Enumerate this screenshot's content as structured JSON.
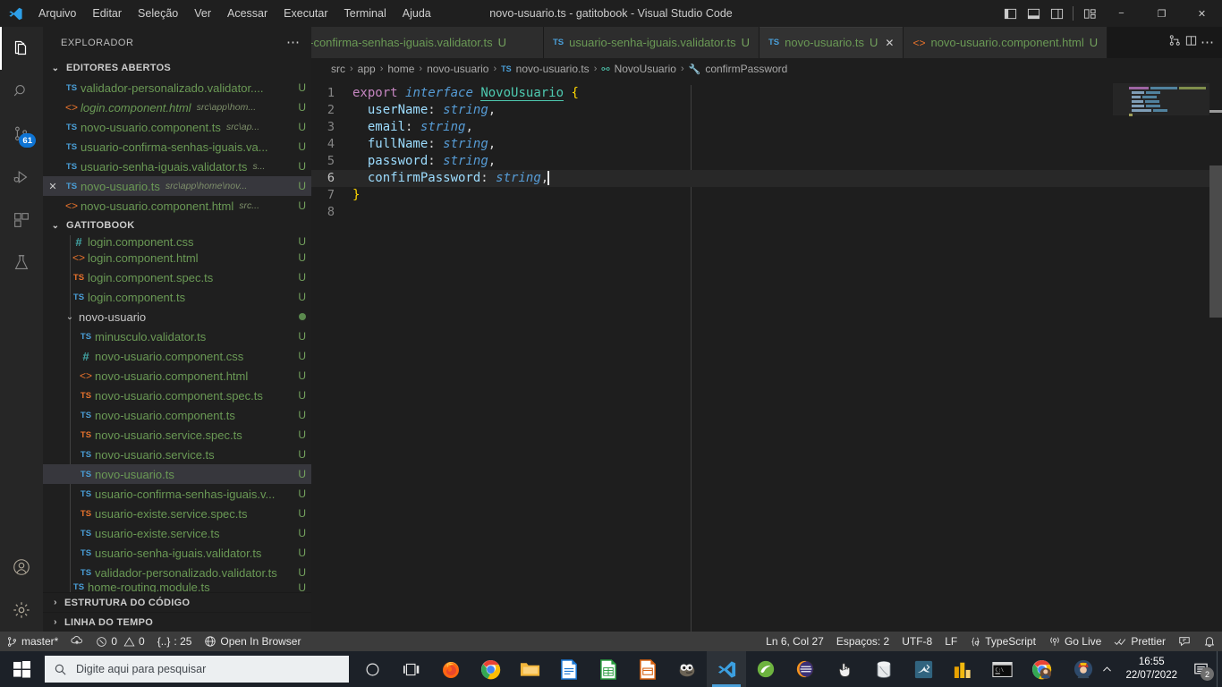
{
  "titlebar": {
    "logo_icon": "vscode-logo-icon",
    "menus": [
      "Arquivo",
      "Editar",
      "Seleção",
      "Ver",
      "Acessar",
      "Executar",
      "Terminal",
      "Ajuda"
    ],
    "window_title": "novo-usuario.ts - gatitobook - Visual Studio Code",
    "layout_icons": [
      "panel-left-icon",
      "panel-bottom-icon",
      "panel-right-icon",
      "customize-layout-icon"
    ],
    "minimize": "−",
    "maximize": "❐",
    "close": "✕"
  },
  "activitybar": {
    "items": [
      {
        "name": "explorer",
        "icon": "files-icon",
        "active": true,
        "badge": ""
      },
      {
        "name": "search",
        "icon": "search-icon",
        "active": false,
        "badge": ""
      },
      {
        "name": "source-control",
        "icon": "source-control-icon",
        "active": false,
        "badge": "61"
      },
      {
        "name": "run-and-debug",
        "icon": "run-debug-icon",
        "active": false,
        "badge": ""
      },
      {
        "name": "extensions",
        "icon": "extensions-icon",
        "active": false,
        "badge": ""
      },
      {
        "name": "testing",
        "icon": "beaker-icon",
        "active": false,
        "badge": ""
      }
    ],
    "bottom": [
      {
        "name": "accounts",
        "icon": "account-icon"
      },
      {
        "name": "manage",
        "icon": "gear-icon"
      }
    ]
  },
  "sidebar": {
    "title": "EXPLORADOR",
    "more_actions": "⋯",
    "open_editors": {
      "label": "EDITORES ABERTOS",
      "items": [
        {
          "icon": "ts",
          "name": "validador-personalizado.validator....",
          "desc": "",
          "status": "U",
          "selected": false,
          "italic": false,
          "close": false
        },
        {
          "icon": "html",
          "name": "login.component.html",
          "desc": "src\\app\\hom...",
          "status": "U",
          "selected": false,
          "italic": true,
          "close": false
        },
        {
          "icon": "ts",
          "name": "novo-usuario.component.ts",
          "desc": "src\\ap...",
          "status": "U",
          "selected": false,
          "italic": false,
          "close": false
        },
        {
          "icon": "ts",
          "name": "usuario-confirma-senhas-iguais.va...",
          "desc": "",
          "status": "U",
          "selected": false,
          "italic": false,
          "close": false
        },
        {
          "icon": "ts",
          "name": "usuario-senha-iguais.validator.ts",
          "desc": "s...",
          "status": "U",
          "selected": false,
          "italic": false,
          "close": false
        },
        {
          "icon": "ts",
          "name": "novo-usuario.ts",
          "desc": "src\\app\\home\\nov...",
          "status": "U",
          "selected": true,
          "italic": false,
          "close": true
        },
        {
          "icon": "html",
          "name": "novo-usuario.component.html",
          "desc": "src...",
          "status": "U",
          "selected": false,
          "italic": false,
          "close": false
        }
      ]
    },
    "workspace": {
      "label": "GATITOBOOK",
      "items": [
        {
          "icon": "css",
          "name": "login.component.css",
          "status": "U",
          "indent": 2,
          "selected": false,
          "folder": false,
          "clipped": true
        },
        {
          "icon": "html",
          "name": "login.component.html",
          "status": "U",
          "indent": 2,
          "selected": false,
          "folder": false
        },
        {
          "icon": "spec",
          "name": "login.component.spec.ts",
          "status": "U",
          "indent": 2,
          "selected": false,
          "folder": false
        },
        {
          "icon": "ts",
          "name": "login.component.ts",
          "status": "U",
          "indent": 2,
          "selected": false,
          "folder": false
        },
        {
          "icon": "folder",
          "name": "novo-usuario",
          "status": "•",
          "indent": 1,
          "selected": false,
          "folder": true
        },
        {
          "icon": "ts",
          "name": "minusculo.validator.ts",
          "status": "U",
          "indent": 2,
          "selected": false,
          "folder": false
        },
        {
          "icon": "css",
          "name": "novo-usuario.component.css",
          "status": "U",
          "indent": 2,
          "selected": false,
          "folder": false
        },
        {
          "icon": "html",
          "name": "novo-usuario.component.html",
          "status": "U",
          "indent": 2,
          "selected": false,
          "folder": false
        },
        {
          "icon": "spec",
          "name": "novo-usuario.component.spec.ts",
          "status": "U",
          "indent": 2,
          "selected": false,
          "folder": false
        },
        {
          "icon": "ts",
          "name": "novo-usuario.component.ts",
          "status": "U",
          "indent": 2,
          "selected": false,
          "folder": false
        },
        {
          "icon": "spec",
          "name": "novo-usuario.service.spec.ts",
          "status": "U",
          "indent": 2,
          "selected": false,
          "folder": false
        },
        {
          "icon": "ts",
          "name": "novo-usuario.service.ts",
          "status": "U",
          "indent": 2,
          "selected": false,
          "folder": false
        },
        {
          "icon": "ts",
          "name": "novo-usuario.ts",
          "status": "U",
          "indent": 2,
          "selected": true,
          "folder": false
        },
        {
          "icon": "ts",
          "name": "usuario-confirma-senhas-iguais.v...",
          "status": "U",
          "indent": 2,
          "selected": false,
          "folder": false
        },
        {
          "icon": "spec",
          "name": "usuario-existe.service.spec.ts",
          "status": "U",
          "indent": 2,
          "selected": false,
          "folder": false
        },
        {
          "icon": "ts",
          "name": "usuario-existe.service.ts",
          "status": "U",
          "indent": 2,
          "selected": false,
          "folder": false
        },
        {
          "icon": "ts",
          "name": "usuario-senha-iguais.validator.ts",
          "status": "U",
          "indent": 2,
          "selected": false,
          "folder": false
        },
        {
          "icon": "ts",
          "name": "validador-personalizado.validator.ts",
          "status": "U",
          "indent": 2,
          "selected": false,
          "folder": false
        },
        {
          "icon": "ts",
          "name": "home-routing.module.ts",
          "status": "U",
          "indent": 1,
          "selected": false,
          "folder": false,
          "clipped": true
        }
      ]
    },
    "outline_label": "ESTRUTURA DO CÓDIGO",
    "timeline_label": "LINHA DO TEMPO"
  },
  "tabs": {
    "items": [
      {
        "icon": "ts",
        "label": "io-confirma-senhas-iguais.validator.ts",
        "status": "U",
        "active": false,
        "close": false,
        "clipped": true
      },
      {
        "icon": "ts",
        "label": "usuario-senha-iguais.validator.ts",
        "status": "U",
        "active": false,
        "close": false,
        "clipped": false
      },
      {
        "icon": "ts",
        "label": "novo-usuario.ts",
        "status": "U",
        "active": true,
        "close": true,
        "clipped": false
      },
      {
        "icon": "html",
        "label": "novo-usuario.component.html",
        "status": "U",
        "active": false,
        "close": false,
        "clipped": false
      }
    ],
    "actions": [
      "split-editor-down-icon",
      "split-editor-right-icon",
      "more-actions-icon"
    ]
  },
  "breadcrumb": {
    "parts": [
      "src",
      "app",
      "home",
      "novo-usuario",
      "novo-usuario.ts",
      "NovoUsuario",
      "confirmPassword"
    ],
    "separator": "›",
    "file_icon": "ts-file-icon",
    "symbol_icon": "interface-icon",
    "property_icon": "property-icon"
  },
  "editor": {
    "lines": [
      {
        "n": "1",
        "current": false
      },
      {
        "n": "2",
        "current": false
      },
      {
        "n": "3",
        "current": false
      },
      {
        "n": "4",
        "current": false
      },
      {
        "n": "5",
        "current": false
      },
      {
        "n": "6",
        "current": true
      },
      {
        "n": "7",
        "current": false
      },
      {
        "n": "8",
        "current": false
      }
    ],
    "code": {
      "l1_export": "export",
      "l1_interface": "interface",
      "l1_name": "NovoUsuario",
      "l1_brace": "{",
      "l2_key": "userName",
      "l2_type": "string",
      "l3_key": "email",
      "l3_type": "string",
      "l4_key": "fullName",
      "l4_type": "string",
      "l5_key": "password",
      "l5_type": "string",
      "l6_key": "confirmPassword",
      "l6_type": "string",
      "l7_brace": "}",
      "colon": ":",
      "comma": ","
    }
  },
  "statusbar": {
    "left": [
      {
        "icon": "source-control-branch-icon",
        "label": "master*"
      },
      {
        "icon": "sync-cloud-icon",
        "label": ""
      },
      {
        "icon": "error-icon",
        "label": "0",
        "icon2": "warning-icon",
        "label2": "0"
      },
      {
        "icon": "braces-icon",
        "label": ": 25",
        "prefix": "{..}"
      },
      {
        "icon": "globe-icon",
        "label": "Open In Browser"
      }
    ],
    "right": [
      {
        "label": "Ln 6, Col 27",
        "name": "cursor-position"
      },
      {
        "label": "Espaços: 2",
        "name": "indentation"
      },
      {
        "label": "UTF-8",
        "name": "encoding"
      },
      {
        "label": "LF",
        "name": "eol"
      },
      {
        "label": "TypeScript",
        "name": "language-mode",
        "icon": "ts-braces-icon"
      },
      {
        "label": "Go Live",
        "name": "go-live",
        "icon": "broadcast-icon"
      },
      {
        "label": "Prettier",
        "name": "prettier",
        "icon": "checkmarks-icon"
      },
      {
        "label": "",
        "name": "remote-window",
        "icon": "feedback-icon"
      },
      {
        "label": "",
        "name": "notifications",
        "icon": "bell-icon"
      }
    ]
  },
  "taskbar": {
    "start_icon": "windows-start-icon",
    "search_placeholder": "Digite aqui para pesquisar",
    "search_icon": "search-icon",
    "items": [
      {
        "name": "cortana",
        "icon": "cortana-icon"
      },
      {
        "name": "task-view",
        "icon": "task-view-icon"
      },
      {
        "name": "firefox",
        "icon": "firefox-icon"
      },
      {
        "name": "chrome",
        "icon": "chrome-icon"
      },
      {
        "name": "file-explorer",
        "icon": "folder-icon"
      },
      {
        "name": "libreoffice-writer",
        "icon": "writer-icon"
      },
      {
        "name": "libreoffice-calc",
        "icon": "calc-icon"
      },
      {
        "name": "libreoffice-impress",
        "icon": "impress-icon"
      },
      {
        "name": "gimp",
        "icon": "gimp-icon"
      },
      {
        "name": "vscode",
        "icon": "vscode-icon",
        "active": true
      },
      {
        "name": "spring-tool-suite",
        "icon": "spring-icon"
      },
      {
        "name": "eclipse",
        "icon": "eclipse-icon"
      },
      {
        "name": "pointer-app",
        "icon": "hand-cursor-icon"
      },
      {
        "name": "database-app",
        "icon": "database-icon"
      },
      {
        "name": "mysql-workbench",
        "icon": "dolphin-icon"
      },
      {
        "name": "power-bi",
        "icon": "power-bi-icon"
      },
      {
        "name": "terminal",
        "icon": "terminal-icon"
      },
      {
        "name": "chrome-profile",
        "icon": "chrome-profile-icon"
      }
    ],
    "tray": {
      "hidden_icons": "⌃",
      "avatar": "user-avatar-icon",
      "time": "16:55",
      "date": "22/07/2022",
      "notification_count": "2",
      "notification_icon": "notification-icon"
    }
  }
}
